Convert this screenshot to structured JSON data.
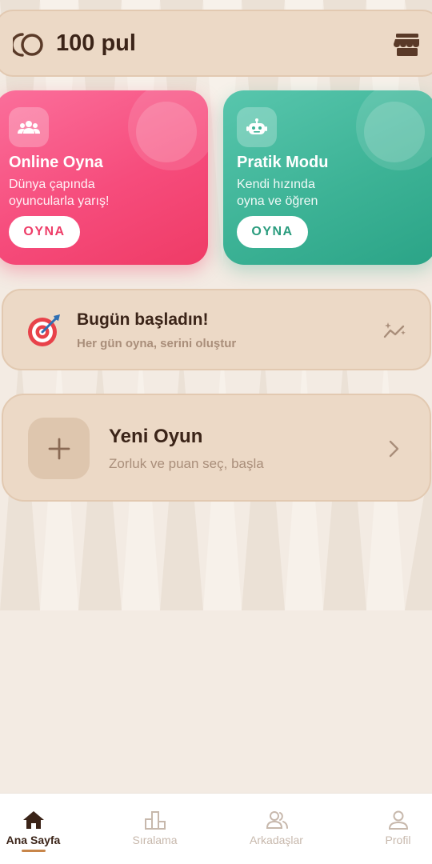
{
  "header": {
    "coins": "100 pul",
    "coin_icon": "coin-icon",
    "shop_icon": "shop-icon"
  },
  "mode_cards": [
    {
      "title": "Online Oyna",
      "description": "Dünya çapında\noyuncularla yarış!",
      "button": "OYNA",
      "icon": "group-icon",
      "color": "#f64c7c"
    },
    {
      "title": "Pratik Modu",
      "description": "Kendi hızında\noyna ve öğren",
      "button": "OYNA",
      "icon": "robot-icon",
      "color": "#3db396"
    }
  ],
  "streak": {
    "title": "Bugün başladın!",
    "subtitle": "Her gün oyna, serini oluştur",
    "icon": "target-icon",
    "trend_icon": "sparkle-trend-icon"
  },
  "new_game": {
    "title": "Yeni Oyun",
    "subtitle": "Zorluk ve puan seç, başla",
    "icon": "plus-icon"
  },
  "bottom_nav": [
    {
      "label": "Ana Sayfa",
      "icon": "home-icon",
      "active": true
    },
    {
      "label": "Sıralama",
      "icon": "leaderboard-icon",
      "active": false
    },
    {
      "label": "Arkadaşlar",
      "icon": "friends-icon",
      "active": false
    },
    {
      "label": "Profil",
      "icon": "profile-icon",
      "active": false
    }
  ],
  "colors": {
    "background": "#f3ebe3",
    "card": "#ecd9c6",
    "accent": "#c8864a",
    "text": "#3b2418"
  }
}
